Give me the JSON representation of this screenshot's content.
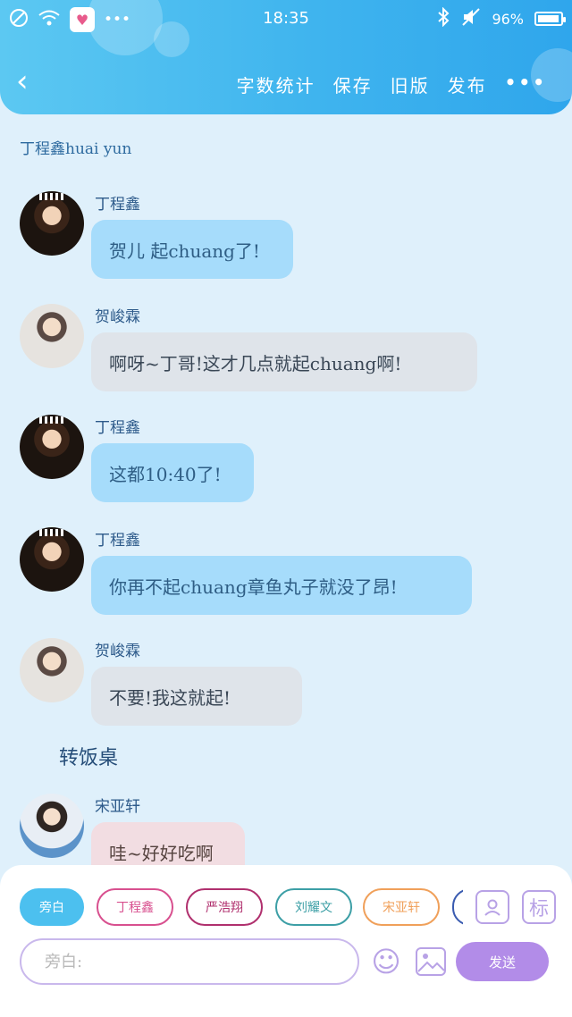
{
  "status_bar": {
    "time": "18:35",
    "battery": "96%",
    "battery_level": 0.96,
    "icons": [
      "blocked-icon",
      "wifi-icon",
      "app-icon",
      "more-dots-icon",
      "bluetooth-icon",
      "mute-icon",
      "battery-icon"
    ],
    "more_dots": "•••"
  },
  "header": {
    "back": "‹",
    "actions": [
      "字数统计",
      "保存",
      "旧版",
      "发布"
    ],
    "more": "•••"
  },
  "chat": {
    "title": "丁程鑫huai yun",
    "messages": [
      {
        "sender": "丁程鑫",
        "text": "贺儿 起chuang了!",
        "style": "blue",
        "avatar": "dark"
      },
      {
        "sender": "贺峻霖",
        "text": "啊呀~丁哥!这才几点就起chuang啊!",
        "style": "grey",
        "avatar": "light"
      },
      {
        "sender": "丁程鑫",
        "text": "这都10:40了!",
        "style": "blue",
        "avatar": "dark"
      },
      {
        "sender": "丁程鑫",
        "text": "你再不起chuang章鱼丸子就没了昂!",
        "style": "blue",
        "avatar": "dark"
      },
      {
        "sender": "贺峻霖",
        "text": "不要!我这就起!",
        "style": "grey",
        "avatar": "light"
      },
      {
        "sender": "宋亚轩",
        "text": "哇~好好吃啊",
        "style": "pink",
        "avatar": "blue"
      }
    ],
    "narration": "转饭桌"
  },
  "composer": {
    "chips": [
      "旁白",
      "丁程鑫",
      "严浩翔",
      "刘耀文",
      "宋亚轩"
    ],
    "chip_colors": [
      "#4cc0ef",
      "#d8508f",
      "#b0306e",
      "#3d9fa6",
      "#f0a05a"
    ],
    "tools": {
      "character": "character-icon",
      "mark": "标"
    },
    "input_placeholder": "旁白:",
    "emoji": "☺",
    "image": "image-icon",
    "send": "发送"
  }
}
